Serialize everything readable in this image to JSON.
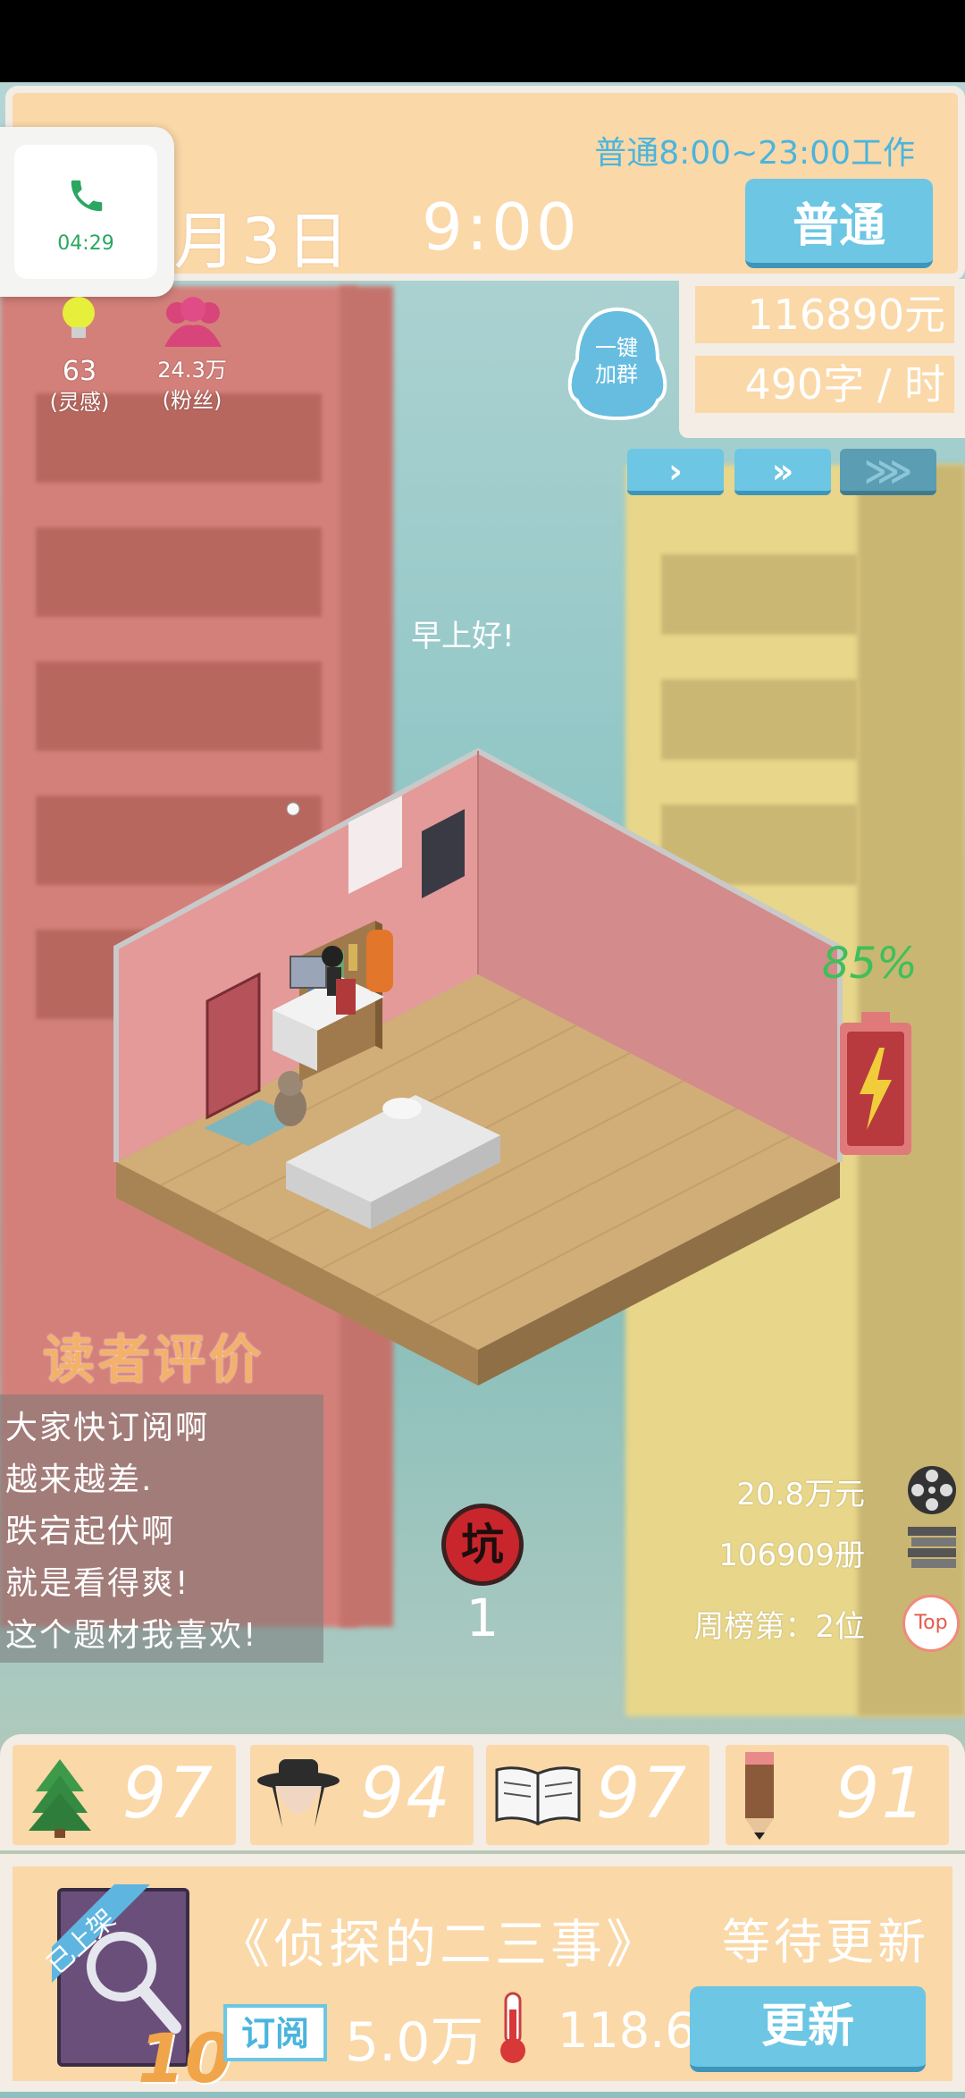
{
  "header": {
    "work_hours": "普通8:00~23:00工作",
    "date": "月3日",
    "time": "9:00",
    "mode_button": "普通"
  },
  "call_widget": {
    "icon": "phone-icon",
    "duration": "04:29"
  },
  "stats_left": {
    "inspiration_value": "63",
    "inspiration_label": "(灵感)",
    "fans_value": "24.3万",
    "fans_label": "(粉丝)"
  },
  "qq_group": {
    "line1": "一键",
    "line2": "加群"
  },
  "money": {
    "balance": "116890元",
    "speed": "490字 / 时"
  },
  "speed_buttons": [
    {
      "label": "›"
    },
    {
      "label": "»"
    },
    {
      "label": "⋙"
    }
  ],
  "greeting": "早上好!",
  "battery": {
    "percent": "85%",
    "level": 0.85
  },
  "reviews": {
    "title": "读者评价",
    "lines": [
      "大家快订阅啊",
      "越来越差.",
      "跌宕起伏啊",
      "就是看得爽!",
      "这个题材我喜欢!"
    ]
  },
  "pit": {
    "label": "坑",
    "count": "1"
  },
  "right_stats": {
    "earnings": "20.8万元",
    "copies": "106909册",
    "rank": "周榜第：2位",
    "rank_badge": "Top"
  },
  "skills": [
    {
      "icon": "tree-icon",
      "value": "97"
    },
    {
      "icon": "detective-icon",
      "value": "94"
    },
    {
      "icon": "book-icon",
      "value": "97"
    },
    {
      "icon": "pencil-icon",
      "value": "91"
    }
  ],
  "book": {
    "shelf_tag": "已上架",
    "level": "10",
    "title": "《侦探的二三事》",
    "status": "等待更新",
    "subscribe_label": "订阅",
    "subscribe_count": "5.0万",
    "heat": "118.6°",
    "update_button": "更新"
  },
  "colors": {
    "accent": "#6cc6e4",
    "panel": "#fad8a8",
    "battery_green": "#3fbf5a"
  }
}
